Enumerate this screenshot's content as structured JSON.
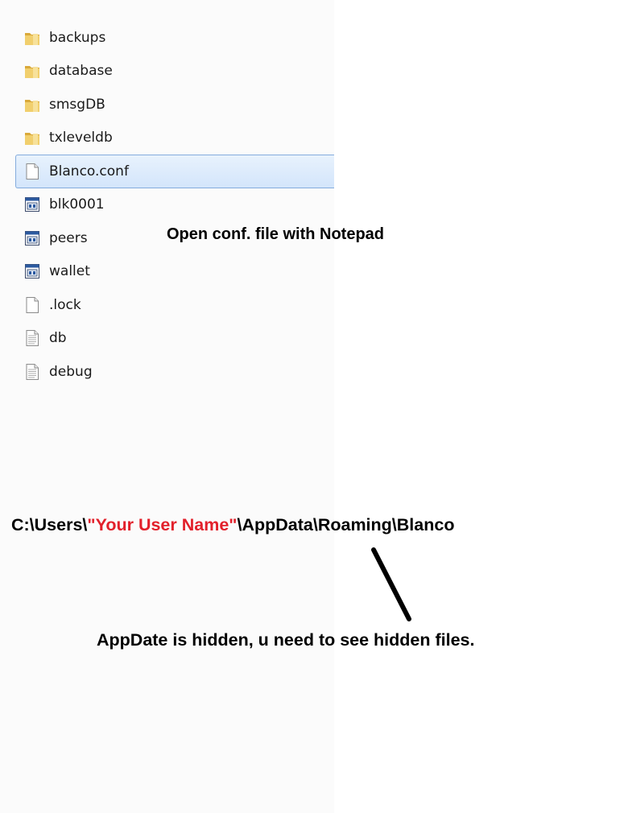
{
  "files": [
    {
      "name": "backups",
      "icon": "folder-icon",
      "type": "folder"
    },
    {
      "name": "database",
      "icon": "folder-icon",
      "type": "folder"
    },
    {
      "name": "smsgDB",
      "icon": "folder-icon",
      "type": "folder"
    },
    {
      "name": "txleveldb",
      "icon": "folder-icon",
      "type": "folder"
    },
    {
      "name": "Blanco.conf",
      "icon": "blank-file-icon",
      "type": "file",
      "selected": true
    },
    {
      "name": "blk0001",
      "icon": "data-file-icon",
      "type": "file"
    },
    {
      "name": "peers",
      "icon": "data-file-icon",
      "type": "file"
    },
    {
      "name": "wallet",
      "icon": "data-file-icon",
      "type": "file"
    },
    {
      "name": ".lock",
      "icon": "blank-file-icon",
      "type": "file"
    },
    {
      "name": "db",
      "icon": "text-file-icon",
      "type": "file"
    },
    {
      "name": "debug",
      "icon": "text-file-icon",
      "type": "file"
    }
  ],
  "captions": {
    "open_conf": "Open conf. file with Notepad",
    "path_prefix": "C:\\Users\\",
    "path_user": "\"Your User Name\"",
    "path_suffix": "\\AppData\\Roaming\\Blanco",
    "hidden_note": "AppDate is hidden, u need to see hidden files."
  },
  "colors": {
    "highlight": "#e2202b",
    "selection_border": "#84acdd",
    "folder": "#e9c25d"
  }
}
